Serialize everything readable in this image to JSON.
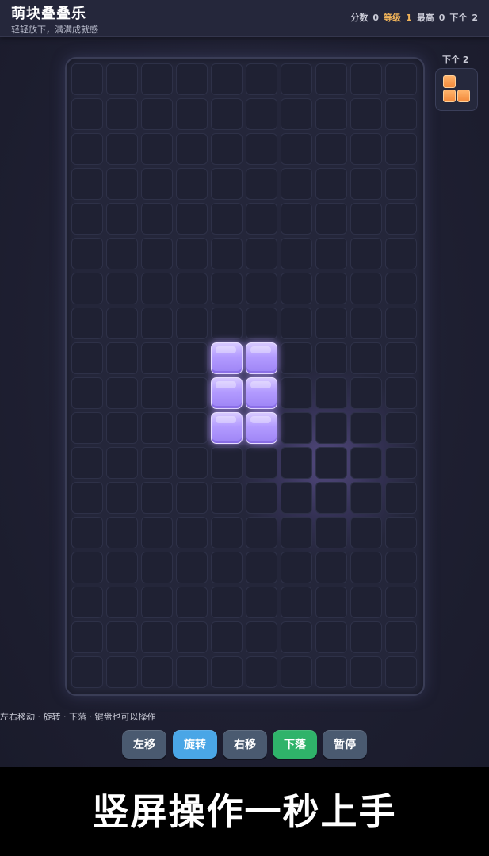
{
  "app": {
    "title": "萌块叠叠乐",
    "subtitle": "轻轻放下，满满成就感"
  },
  "stats": {
    "score_label": "分数",
    "score": "0",
    "level_label": "等级",
    "level": "1",
    "best_label": "最高",
    "best": "0",
    "next_label": "下个",
    "next": "2"
  },
  "board": {
    "columns": 10,
    "rows": 18,
    "active_piece": {
      "color": "#b39bff",
      "cells": [
        [
          4,
          8
        ],
        [
          5,
          8
        ],
        [
          4,
          9
        ],
        [
          5,
          9
        ],
        [
          4,
          10
        ],
        [
          5,
          10
        ]
      ]
    }
  },
  "preview": {
    "label": "下个 2",
    "color": "#f38a3b",
    "cells": [
      [
        0,
        0
      ],
      [
        0,
        1
      ],
      [
        1,
        1
      ]
    ]
  },
  "hint": "左右移动 · 旋转 · 下落 · 键盘也可以操作",
  "controls": {
    "left": "左移",
    "rotate": "旋转",
    "right": "右移",
    "drop": "下落",
    "pause": "暂停"
  },
  "banner": {
    "text": "竖屏操作一秒上手"
  },
  "colors": {
    "level_accent": "#f0b35a",
    "rotate_button": "#4aa6e6",
    "drop_button": "#2fb36a",
    "neutral_button": "#4a5a70"
  }
}
